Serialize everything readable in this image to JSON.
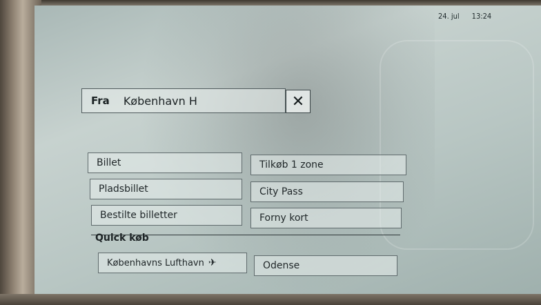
{
  "status": {
    "date": "24. jul",
    "time": "13:24"
  },
  "from": {
    "label": "Fra",
    "value": "København H",
    "clear_icon": "✕"
  },
  "tickets": {
    "left": [
      "Billet",
      "Pladsbillet",
      "Bestilte billetter"
    ],
    "right": [
      "Tilkøb 1 zone",
      "City Pass",
      "Forny kort"
    ]
  },
  "quick": {
    "title": "Quick køb",
    "airport": "Københavns Lufthavn",
    "airport_icon": "✈",
    "odense": "Odense"
  }
}
